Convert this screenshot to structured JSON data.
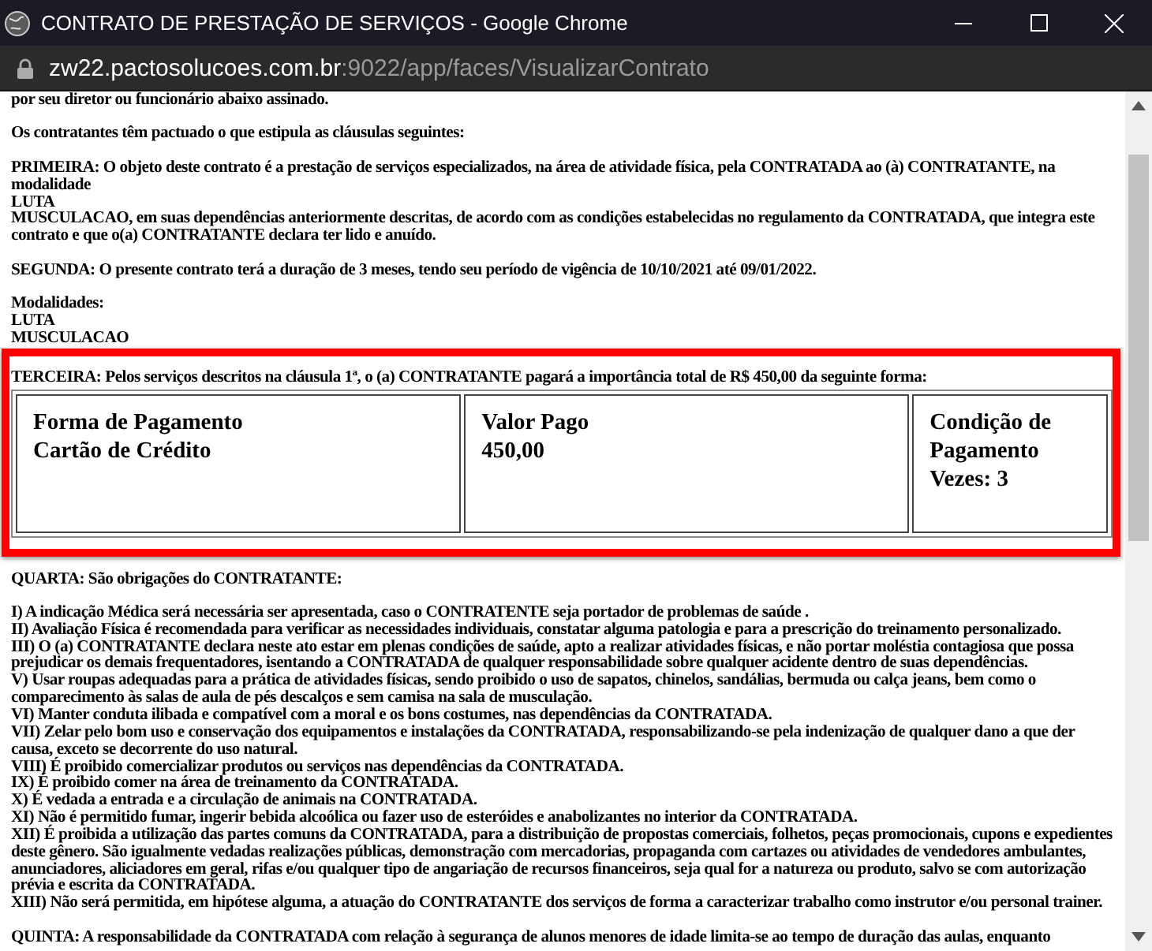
{
  "window": {
    "title": "CONTRATO DE PRESTAÇÃO DE SERVIÇOS - Google Chrome"
  },
  "address_bar": {
    "host": "zw22.pactosolucoes.com.br",
    "path": ":9022/app/faces/VisualizarContrato"
  },
  "document": {
    "blocks": [
      {
        "kind": "text",
        "lines": [
          "por seu diretor ou funcionário abaixo assinado."
        ]
      },
      {
        "kind": "text",
        "lines": [
          "Os contratantes têm pactuado o que estipula as cláusulas seguintes:"
        ]
      },
      {
        "kind": "text",
        "lines": [
          "PRIMEIRA: O objeto deste contrato é a prestação de serviços especializados, na área de atividade física, pela CONTRATADA ao (à) CONTRATANTE, na modalidade",
          "LUTA",
          "MUSCULACAO, em suas dependências anteriormente descritas, de acordo com as condições estabelecidas no regulamento da CONTRATADA, que integra este contrato e que o(a) CONTRATANTE declara ter lido e anuído."
        ]
      },
      {
        "kind": "text",
        "lines": [
          "SEGUNDA: O presente contrato terá a duração de 3 meses, tendo seu período de vigência de 10/10/2021 até 09/01/2022."
        ]
      },
      {
        "kind": "text",
        "lines": [
          "Modalidades:",
          "LUTA",
          "MUSCULACAO"
        ]
      },
      {
        "kind": "payment_table",
        "highlighted": true,
        "intro": "TERCEIRA: Pelos serviços descritos na cláusula 1ª, o (a) CONTRATANTE pagará a importância total de R$ 450,00 da seguinte forma:",
        "cells": [
          {
            "lines": [
              "Forma de Pagamento",
              "Cartão de Crédito"
            ]
          },
          {
            "lines": [
              "Valor Pago",
              "450,00"
            ]
          },
          {
            "lines": [
              "Condição de Pagamento",
              "Vezes: 3"
            ]
          }
        ]
      },
      {
        "kind": "text",
        "lines": [
          "QUARTA: São obrigações do CONTRATANTE:"
        ]
      },
      {
        "kind": "text",
        "lines": [
          "I) A indicação Médica será necessária ser apresentada, caso o CONTRATENTE seja portador de  problemas de saúde .",
          "II) Avaliação Física é recomendada para verificar as necessidades individuais, constatar alguma patologia e para a prescrição do treinamento personalizado.",
          "III) O (a) CONTRATANTE declara neste ato estar em plenas condições de saúde, apto a realizar atividades físicas, e não portar moléstia contagiosa que possa prejudicar os demais frequentadores, isentando a CONTRATADA de qualquer responsabilidade sobre qualquer acidente dentro de suas dependências.",
          "V) Usar roupas adequadas para a prática de atividades físicas, sendo proibido o uso de sapatos, chinelos, sandálias, bermuda ou calça jeans, bem como o comparecimento às salas de aula de pés descalços e sem camisa na sala de musculação.",
          "VI) Manter conduta ilibada e compatível com a moral e os bons costumes, nas dependências da CONTRATADA.",
          "VII) Zelar pelo bom uso e conservação dos equipamentos e instalações da CONTRATADA, responsabilizando-se pela indenização de qualquer dano a que der causa, exceto se decorrente do uso natural.",
          "VIII) É proibido comercializar produtos ou serviços nas dependências da CONTRATADA.",
          "IX) É proibido comer na área de treinamento  da CONTRATADA.",
          "X) É vedada a entrada e a circulação de animais na CONTRATADA.",
          "XI)  Não é permitido fumar, ingerir bebida alcoólica ou fazer uso de esteróides e anabolizantes no interior da CONTRATADA.",
          "XII) É proibida a utilização das partes comuns da CONTRATADA, para a distribuição de propostas comerciais, folhetos, peças promocionais, cupons e expedientes deste gênero. São igualmente vedadas realizações públicas, demonstração com mercadorias, propaganda com cartazes ou atividades de vendedores ambulantes, anunciadores, aliciadores em geral, rifas e/ou qualquer tipo de angariação de recursos financeiros, seja qual for a natureza ou produto, salvo se com autorização prévia e escrita da  CONTRATADA.",
          "XIII) Não será permitida, em hipótese alguma, a atuação do CONTRATANTE dos serviços de forma a caracterizar trabalho como instrutor e/ou personal trainer."
        ]
      },
      {
        "kind": "text",
        "lines": [
          "QUINTA: A responsabilidade da CONTRATADA com relação à segurança de alunos menores de idade limita-se ao tempo de duração das aulas, enquanto"
        ]
      }
    ]
  }
}
